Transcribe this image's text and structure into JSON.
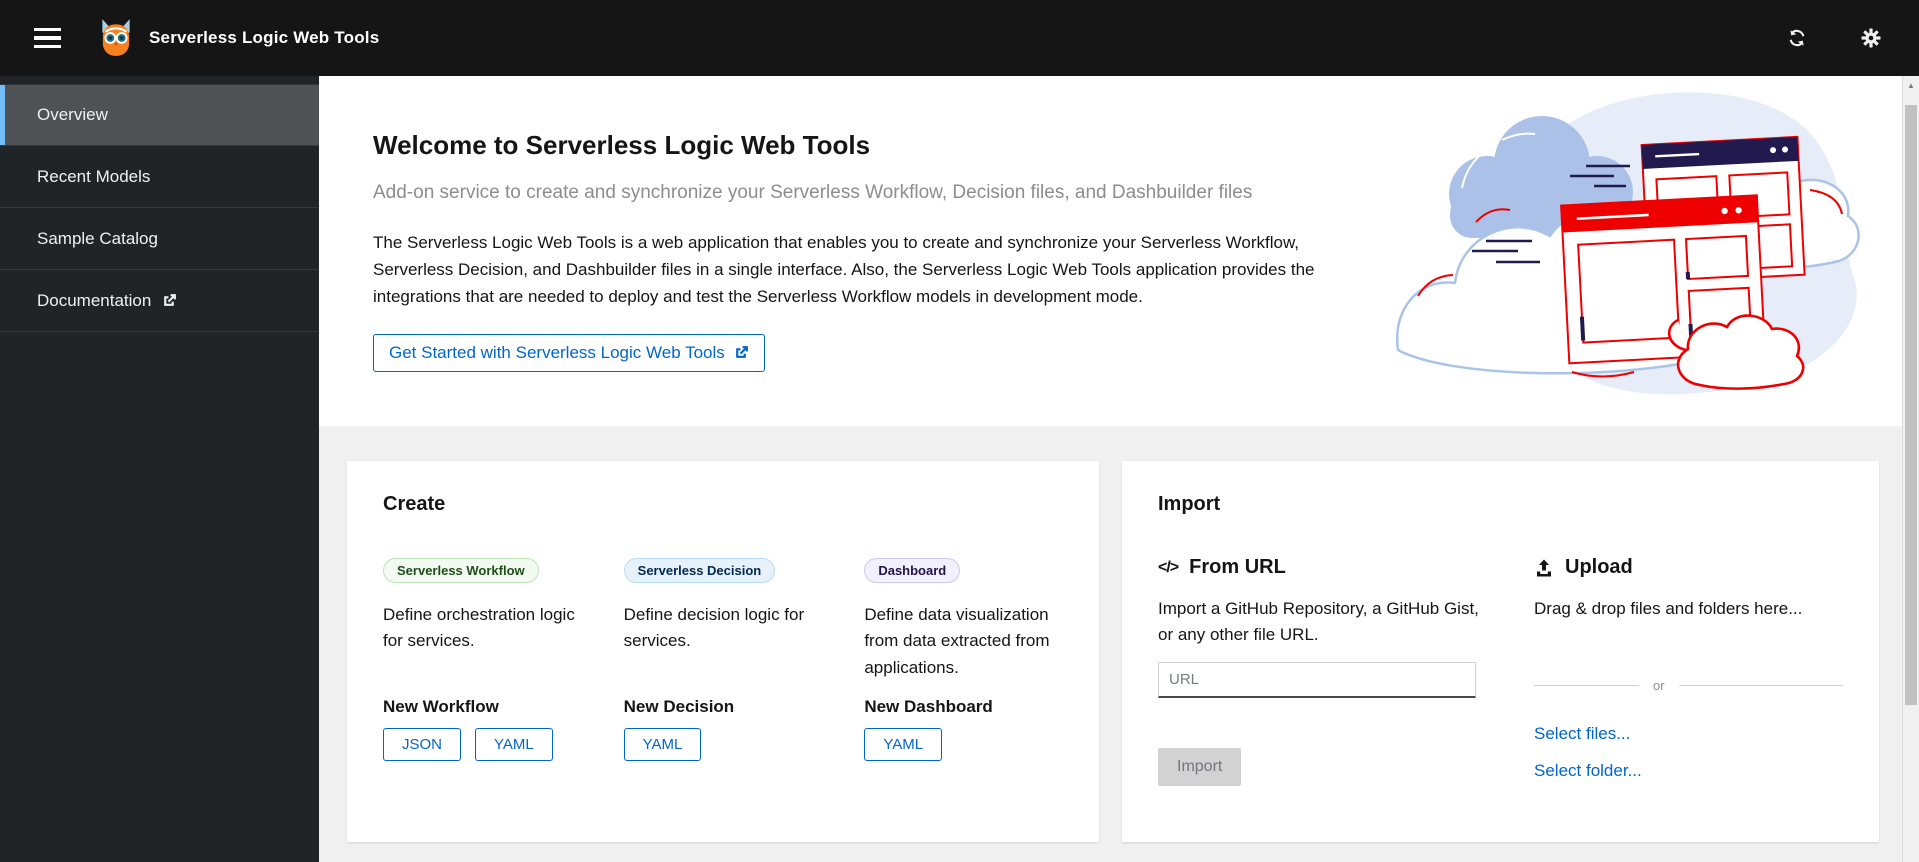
{
  "header": {
    "title": "Serverless Logic Web Tools"
  },
  "sidebar": {
    "items": [
      {
        "label": "Overview",
        "selected": true
      },
      {
        "label": "Recent Models",
        "selected": false
      },
      {
        "label": "Sample Catalog",
        "selected": false
      },
      {
        "label": "Documentation",
        "selected": false,
        "external": true
      }
    ]
  },
  "welcome": {
    "title": "Welcome to Serverless Logic Web Tools",
    "subtitle": "Add-on service to create and synchronize your Serverless Workflow, Decision files, and Dashbuilder files",
    "body": "The Serverless Logic Web Tools is a web application that enables you to create and synchronize your Serverless Workflow, Serverless Decision, and Dashbuilder files in a single interface. Also, the Serverless Logic Web Tools application provides the integrations that are needed to deploy and test the Serverless Workflow models in development mode.",
    "cta_label": "Get Started with Serverless Logic Web Tools"
  },
  "create_card": {
    "title": "Create",
    "columns": [
      {
        "badge": "Serverless Workflow",
        "description": "Define orchestration logic for services.",
        "heading": "New Workflow",
        "buttons": [
          "JSON",
          "YAML"
        ]
      },
      {
        "badge": "Serverless Decision",
        "description": "Define decision logic for services.",
        "heading": "New Decision",
        "buttons": [
          "YAML"
        ]
      },
      {
        "badge": "Dashboard",
        "description": "Define data visualization from data extracted from applications.",
        "heading": "New Dashboard",
        "buttons": [
          "YAML"
        ]
      }
    ]
  },
  "import_card": {
    "title": "Import",
    "from_url": {
      "heading": "From URL",
      "description": "Import a GitHub Repository, a GitHub Gist, or any other file URL.",
      "input_value": "",
      "input_placeholder": "URL",
      "button_label": "Import",
      "button_disabled": true
    },
    "upload": {
      "heading": "Upload",
      "description": "Drag & drop files and folders here...",
      "divider_text": "or",
      "links": [
        "Select files...",
        "Select folder..."
      ]
    }
  },
  "icons": {
    "code_glyph": "</>",
    "scroll_up_glyph": "▲"
  },
  "colors": {
    "accent_blue": "#0066cc",
    "masthead_bg": "#151515",
    "sidebar_bg": "#212427",
    "sidebar_selected_bg": "#4f5255",
    "sidebar_active_indicator": "#73bcf7",
    "page_bg": "#f0f0f0",
    "disabled_button_bg": "#d2d2d2",
    "badge_workflow_text": "#1e4f18",
    "badge_decision_text": "#002952",
    "badge_dashboard_text": "#21134d",
    "illustration_navy": "#221a4e",
    "illustration_red": "#ee0000"
  }
}
